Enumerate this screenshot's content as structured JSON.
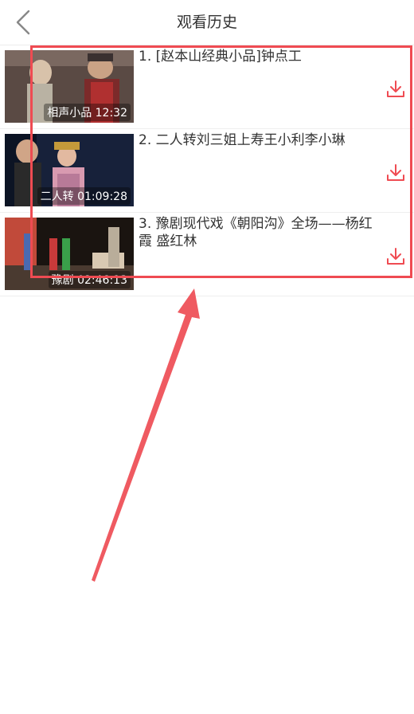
{
  "header": {
    "title": "观看历史",
    "back_icon": "chevron-left-icon"
  },
  "history": [
    {
      "title": "1. [赵本山经典小品]钟点工",
      "caption": "相声小品 12:32",
      "download_icon": "download-icon"
    },
    {
      "title": "2. 二人转刘三姐上寿王小利李小琳",
      "caption": "二人转 01:09:28",
      "download_icon": "download-icon"
    },
    {
      "title": "3. 豫剧现代戏《朝阳沟》全场——杨红霞 盛红林",
      "caption": "豫剧 02:46:13",
      "download_icon": "download-icon"
    }
  ],
  "colors": {
    "accent": "#ef4b52",
    "annotation": "#ef4b52"
  }
}
